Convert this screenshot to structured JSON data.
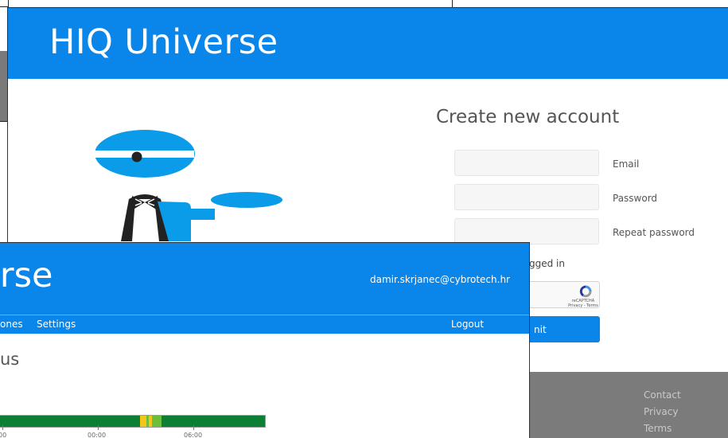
{
  "background": {
    "colors": {
      "border": "#222222",
      "gray": "#7a7a7a"
    }
  },
  "signup_window": {
    "header": {
      "title": "HIQ Universe",
      "color": "#0a85e9"
    },
    "illustration": {
      "name": "waiter-illustration",
      "color": "#0a9be9"
    },
    "form": {
      "heading": "Create new account",
      "fields": [
        {
          "label": "Email",
          "value": "",
          "placeholder": ""
        },
        {
          "label": "Password",
          "value": "",
          "placeholder": ""
        },
        {
          "label": "Repeat password",
          "value": "",
          "placeholder": ""
        }
      ],
      "keep_logged_in_text": "gged in",
      "recaptcha": {
        "brand": "reCAPTCHA",
        "links": "Privacy - Terms"
      },
      "submit_label": "nit"
    },
    "footer": {
      "links": [
        "Contact",
        "Privacy",
        "Terms"
      ],
      "color": "#7b7b7b"
    }
  },
  "dashboard_window": {
    "header": {
      "title": "verse",
      "user_email": "damir.skrjanec@cybrotech.hr"
    },
    "nav": {
      "items": [
        "ones",
        "Settings"
      ],
      "logout_label": "Logout"
    },
    "section_heading": "us",
    "timeline": {
      "colors": {
        "ok": "#0b7f34",
        "warn": "#f5c518",
        "light": "#6bbf3a"
      },
      "tick_labels": [
        "00",
        "00:00",
        "06:00"
      ]
    }
  }
}
